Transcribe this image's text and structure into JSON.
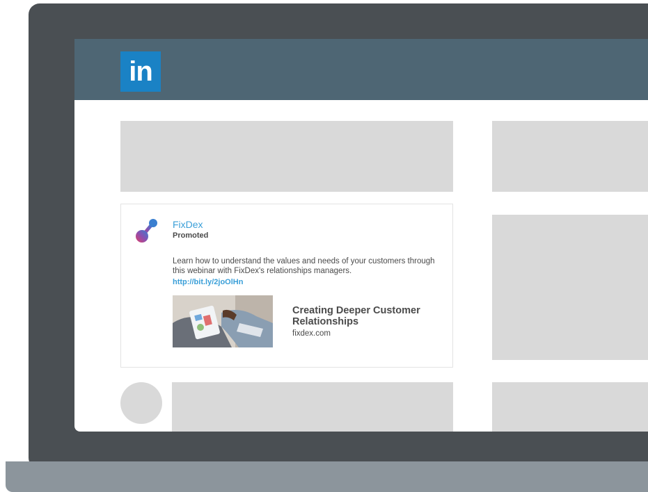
{
  "header": {
    "logo_text": "in",
    "logo_color": "#1a82c5",
    "bar_color": "#4e6674"
  },
  "ad": {
    "company_name": "FixDex",
    "label": "Promoted",
    "body_text": "Learn how to understand the values and needs of your customers through this webinar with FixDex's relationships managers.",
    "link": "http://bit.ly/2joOlHn",
    "article_title": "Creating Deeper Customer Relationships",
    "article_domain": "fixdex.com",
    "brand_colors": [
      "#3a7fd0",
      "#e0406a"
    ]
  }
}
